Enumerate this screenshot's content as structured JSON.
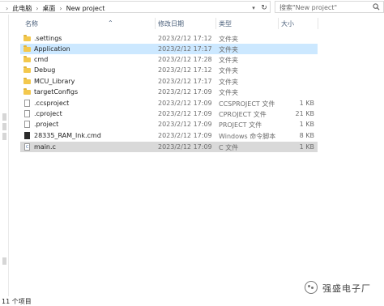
{
  "address_bar": {
    "crumbs": [
      "此电脑",
      "桌面",
      "New project"
    ],
    "search_placeholder": "搜索\"New project\""
  },
  "columns": {
    "name": "名称",
    "date": "修改日期",
    "type": "类型",
    "size": "大小"
  },
  "files": [
    {
      "name": ".settings",
      "date": "2023/2/12 17:12",
      "type": "文件夹",
      "size": "",
      "icon": "folder-icon"
    },
    {
      "name": "Application",
      "date": "2023/2/12 17:17",
      "type": "文件夹",
      "size": "",
      "icon": "folder-icon"
    },
    {
      "name": "cmd",
      "date": "2023/2/12 17:28",
      "type": "文件夹",
      "size": "",
      "icon": "folder-icon"
    },
    {
      "name": "Debug",
      "date": "2023/2/12 17:12",
      "type": "文件夹",
      "size": "",
      "icon": "folder-icon"
    },
    {
      "name": "MCU_Library",
      "date": "2023/2/12 17:17",
      "type": "文件夹",
      "size": "",
      "icon": "folder-icon"
    },
    {
      "name": "targetConfigs",
      "date": "2023/2/12 17:09",
      "type": "文件夹",
      "size": "",
      "icon": "folder-icon"
    },
    {
      "name": ".ccsproject",
      "date": "2023/2/12 17:09",
      "type": "CCSPROJECT 文件",
      "size": "1 KB",
      "icon": "file-icon"
    },
    {
      "name": ".cproject",
      "date": "2023/2/12 17:09",
      "type": "CPROJECT 文件",
      "size": "21 KB",
      "icon": "file-icon"
    },
    {
      "name": ".project",
      "date": "2023/2/12 17:09",
      "type": "PROJECT 文件",
      "size": "1 KB",
      "icon": "file-icon"
    },
    {
      "name": "28335_RAM_lnk.cmd",
      "date": "2023/2/12 17:09",
      "type": "Windows 命令脚本",
      "size": "8 KB",
      "icon": "cmd-file-icon"
    },
    {
      "name": "main.c",
      "date": "2023/2/12 17:09",
      "type": "C 文件",
      "size": "1 KB",
      "icon": "c-file-icon"
    }
  ],
  "status": {
    "count": "11 个项目"
  },
  "watermark": {
    "text": "强盛电子厂"
  },
  "colors": {
    "selection": "#cce8ff",
    "selection_inactive": "#d9d9d9",
    "folder": "#f3c84d",
    "header_text": "#4a5f7a"
  }
}
